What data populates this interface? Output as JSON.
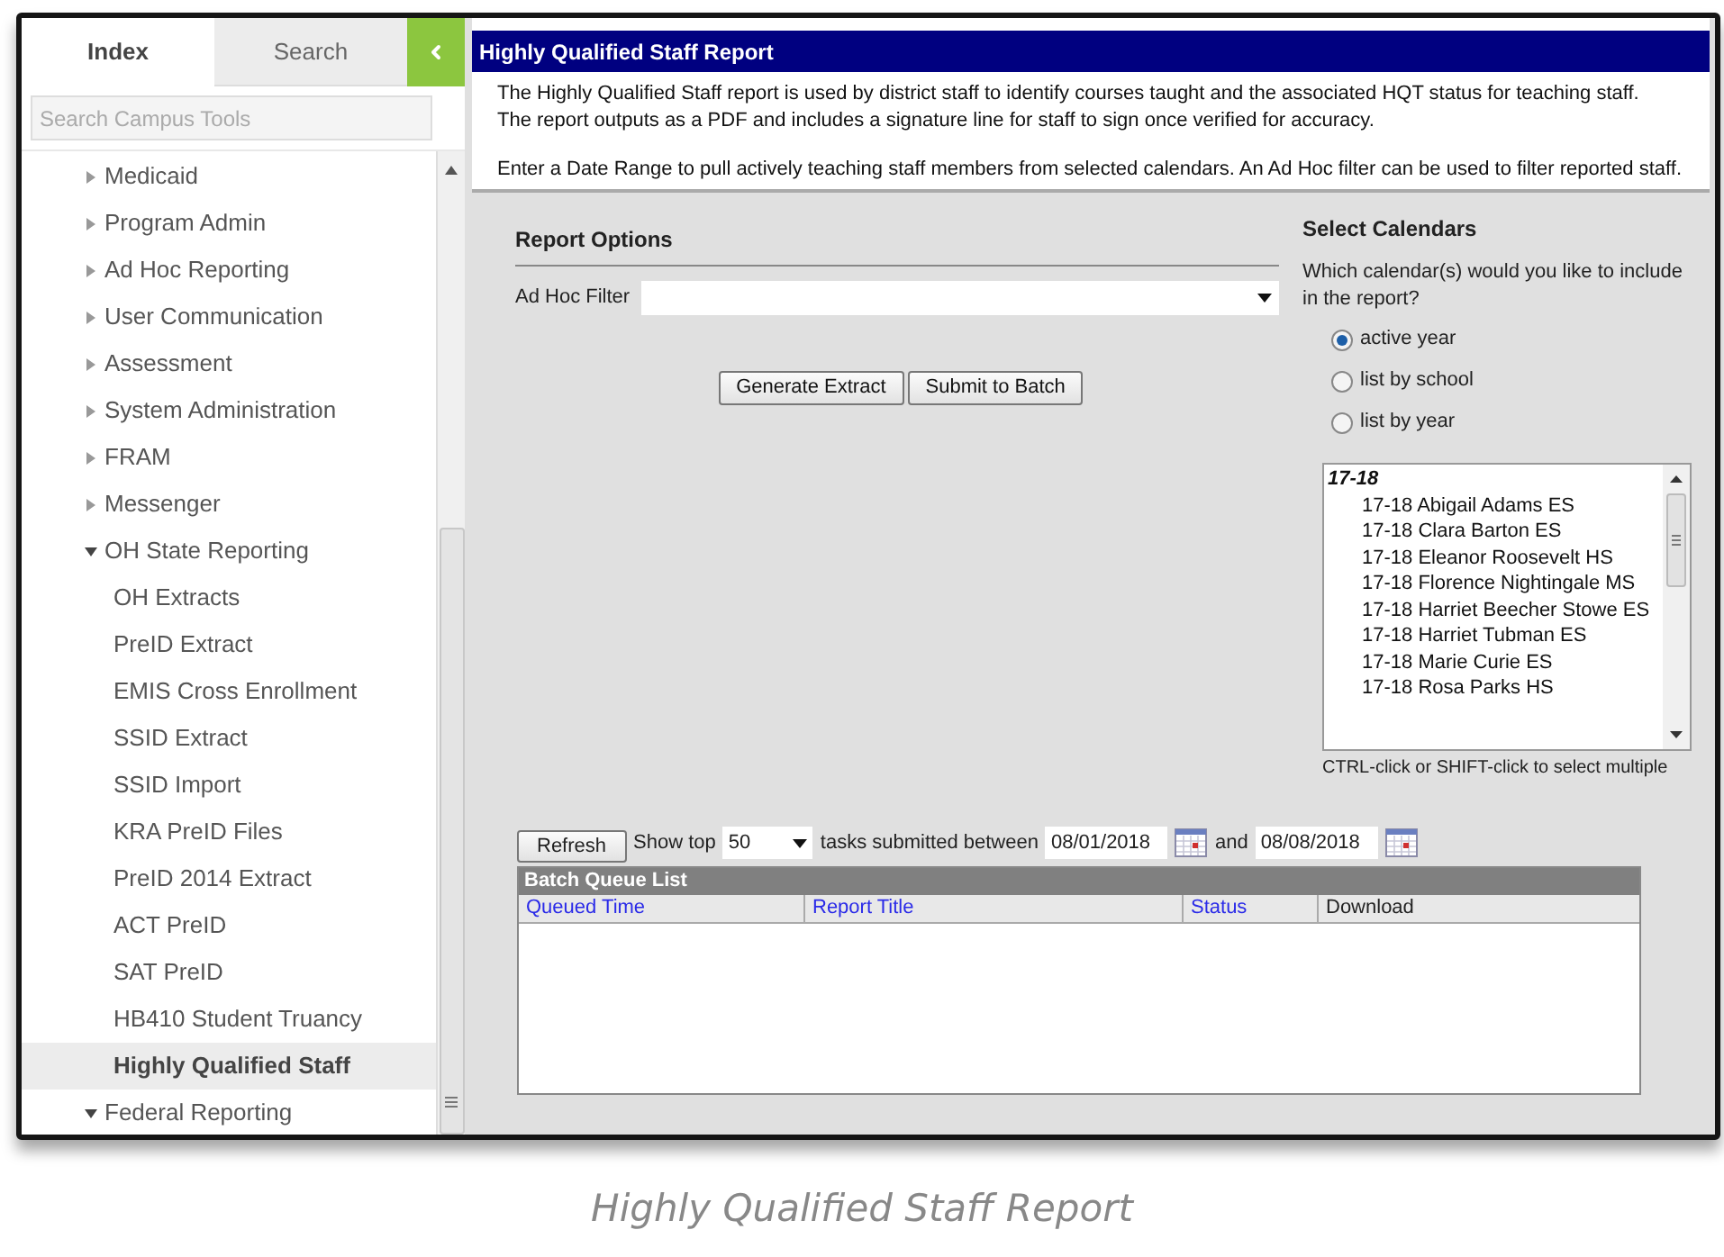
{
  "sidebar": {
    "tabs": [
      {
        "label": "Index",
        "selected": true
      },
      {
        "label": "Search",
        "selected": false
      }
    ],
    "search": {
      "placeholder": "Search Campus Tools"
    },
    "items": [
      {
        "label": "Medicaid",
        "expanded": false
      },
      {
        "label": "Program Admin",
        "expanded": false
      },
      {
        "label": "Ad Hoc Reporting",
        "expanded": false
      },
      {
        "label": "User Communication",
        "expanded": false
      },
      {
        "label": "Assessment",
        "expanded": false
      },
      {
        "label": "System Administration",
        "expanded": false
      },
      {
        "label": "FRAM",
        "expanded": false
      },
      {
        "label": "Messenger",
        "expanded": false
      },
      {
        "label": "OH State Reporting",
        "expanded": true,
        "children": [
          {
            "label": "OH Extracts",
            "selected": false
          },
          {
            "label": "PreID Extract",
            "selected": false
          },
          {
            "label": "EMIS Cross Enrollment",
            "selected": false
          },
          {
            "label": "SSID Extract",
            "selected": false
          },
          {
            "label": "SSID Import",
            "selected": false
          },
          {
            "label": "KRA PreID Files",
            "selected": false
          },
          {
            "label": "PreID 2014 Extract",
            "selected": false
          },
          {
            "label": "ACT PreID",
            "selected": false
          },
          {
            "label": "SAT PreID",
            "selected": false
          },
          {
            "label": "HB410 Student Truancy",
            "selected": false
          },
          {
            "label": "Highly Qualified Staff",
            "selected": true
          }
        ]
      },
      {
        "label": "Federal Reporting",
        "expanded": true
      }
    ]
  },
  "report": {
    "title": "Highly Qualified Staff Report",
    "description": [
      [
        "The Highly Qualified Staff report is used by district staff to identify courses taught and the associated HQT status for teaching staff.",
        "The report outputs as a PDF and includes a signature line for staff to sign once verified for accuracy."
      ],
      [
        "Enter a Date Range to pull actively teaching staff members from selected calendars. An Ad Hoc filter can be used to filter reported staff."
      ]
    ]
  },
  "report_options": {
    "heading": "Report Options",
    "ad_hoc_filter_label": "Ad Hoc Filter",
    "buttons": [
      "Generate Extract",
      "Submit to Batch"
    ]
  },
  "select_calendars": {
    "heading": "Select Calendars",
    "question": "Which calendar(s) would you like to include in the report?",
    "options": [
      {
        "label": "active year",
        "selected": true
      },
      {
        "label": "list by school",
        "selected": false
      },
      {
        "label": "list by year",
        "selected": false
      }
    ],
    "group": "17-18",
    "calendars": [
      "17-18 Abigail Adams ES",
      "17-18 Clara Barton ES",
      "17-18 Eleanor Roosevelt HS",
      "17-18 Florence Nightingale MS",
      "17-18 Harriet Beecher Stowe ES",
      "17-18 Harriet Tubman ES",
      "17-18 Marie Curie ES",
      "17-18 Rosa Parks HS"
    ],
    "hint": "CTRL-click or SHIFT-click to select multiple"
  },
  "batch": {
    "refresh": "Refresh",
    "show_top": "Show top",
    "count": "50",
    "submitted_between": "tasks submitted between",
    "start_date": "08/01/2018",
    "and": "and",
    "end_date": "08/08/2018",
    "title": "Batch Queue List",
    "columns": [
      {
        "label": "Queued Time",
        "sortable": true
      },
      {
        "label": "Report Title",
        "sortable": true
      },
      {
        "label": "Status",
        "sortable": true
      },
      {
        "label": "Download",
        "sortable": false
      }
    ]
  },
  "caption": "Highly Qualified Staff Report"
}
